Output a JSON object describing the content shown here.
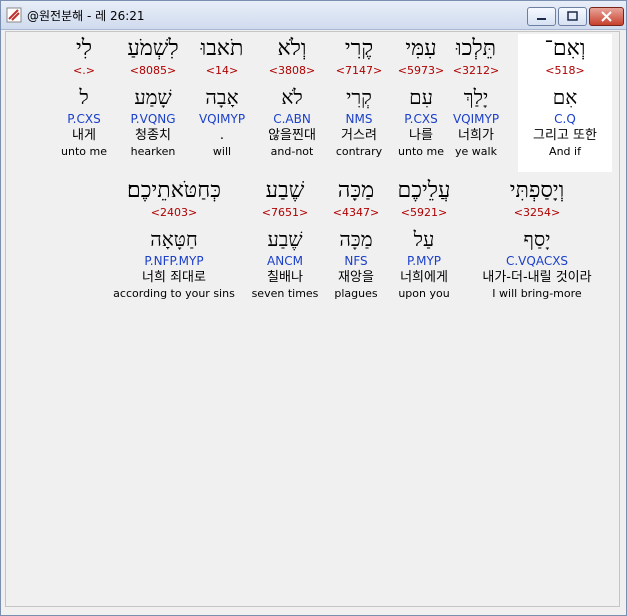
{
  "window": {
    "title": "@원전분해 - 레 26:21",
    "icon": "app-icon"
  },
  "row1": [
    {
      "hebrew": "וְאִם־",
      "strong": "<518>",
      "lemma": "אִם",
      "morph": "C.Q",
      "korean": "그리고 또한",
      "english": "And if",
      "selected": true
    },
    {
      "hebrew": "תֵּלְכוּ",
      "strong": "<3212>",
      "lemma": "יָלַךְ",
      "morph": "VQIMYP",
      "korean": "너희가",
      "english": "ye walk"
    },
    {
      "hebrew": "עִמִּי",
      "strong": "<5973>",
      "lemma": "עִם",
      "morph": "P.CXS",
      "korean": "나를",
      "english": "unto me"
    },
    {
      "hebrew": "קֶרִי",
      "strong": "<7147>",
      "lemma": "קְרִי",
      "morph": "NMS",
      "korean": "거스려",
      "english": "contrary"
    },
    {
      "hebrew": "וְלֹא",
      "strong": "<3808>",
      "lemma": "לֹא",
      "morph": "C.ABN",
      "korean": "않을찐대",
      "english": "and-not"
    },
    {
      "hebrew": "תֹאבוּ",
      "strong": "<14>",
      "lemma": "אָבָה",
      "morph": "VQIMYP",
      "korean": ".",
      "english": "will"
    },
    {
      "hebrew": "לִשְׁמֹעַ",
      "strong": "<8085>",
      "lemma": "שָׁמַע",
      "morph": "P.VQNG",
      "korean": "청종치",
      "english": "hearken"
    },
    {
      "hebrew": "לִי",
      "strong": "<.>",
      "lemma": "ל",
      "morph": "P.CXS",
      "korean": "내게",
      "english": "unto me"
    }
  ],
  "row2": [
    {
      "hebrew": "וְיָסַפְתִּי",
      "strong": "<3254>",
      "lemma": "יָסַף",
      "morph": "C.VQACXS",
      "korean": "내가-더-내릴 것이라",
      "english": "I will bring-more"
    },
    {
      "hebrew": "עֲלֵיכֶם",
      "strong": "<5921>",
      "lemma": "עַל",
      "morph": "P.MYP",
      "korean": "너희에게",
      "english": "upon you"
    },
    {
      "hebrew": "מַכָּה",
      "strong": "<4347>",
      "lemma": "מַכָּה",
      "morph": "NFS",
      "korean": "재앙을",
      "english": "plagues"
    },
    {
      "hebrew": "שֶׁבַע",
      "strong": "<7651>",
      "lemma": "שֶׁבַע",
      "morph": "ANCM",
      "korean": "칠배나",
      "english": "seven times"
    },
    {
      "hebrew": "כְּחַטֹּאתֵיכֶם׃",
      "strong": "<2403>",
      "lemma": "חַטָּאָה",
      "morph": "P.NFP.MYP",
      "korean": "너희 죄대로",
      "english": "according to your sins"
    }
  ]
}
